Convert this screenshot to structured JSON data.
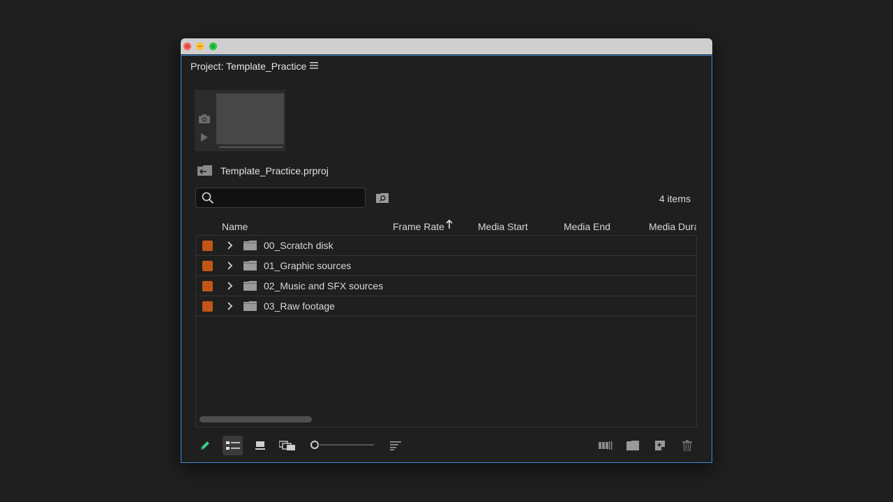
{
  "window": {
    "close_glyph": "×",
    "minimize_glyph": "−",
    "maximize_glyph": "+"
  },
  "panel": {
    "title": "Project: Template_Practice",
    "menu_icon": "hamburger-menu-icon"
  },
  "project": {
    "file_name": "Template_Practice.prproj"
  },
  "search": {
    "placeholder": "",
    "value": ""
  },
  "status": {
    "item_count": "4 items"
  },
  "columns": {
    "name": "Name",
    "frame_rate": "Frame Rate",
    "media_start": "Media Start",
    "media_end": "Media End",
    "media_duration": "Media Dura"
  },
  "sort": {
    "column": "Frame Rate",
    "direction": "ascending"
  },
  "items": [
    {
      "name": "00_Scratch disk",
      "label_color": "#c25616"
    },
    {
      "name": "01_Graphic sources",
      "label_color": "#c25616"
    },
    {
      "name": "02_Music and SFX sources",
      "label_color": "#c25616"
    },
    {
      "name": "03_Raw footage",
      "label_color": "#c25616"
    }
  ],
  "colors": {
    "accent_focus": "#3d8ad6",
    "pencil": "#3cc88c",
    "label_orange": "#c25616"
  },
  "toolbar": {
    "left": [
      "pencil-icon",
      "list-view-icon",
      "icon-view-icon",
      "freeform-view-icon",
      "zoom-slider",
      "sort-icons-icon"
    ],
    "right": [
      "automate-to-sequence-icon",
      "new-bin-icon",
      "new-item-icon",
      "trash-icon"
    ],
    "active_view": "list-view"
  }
}
